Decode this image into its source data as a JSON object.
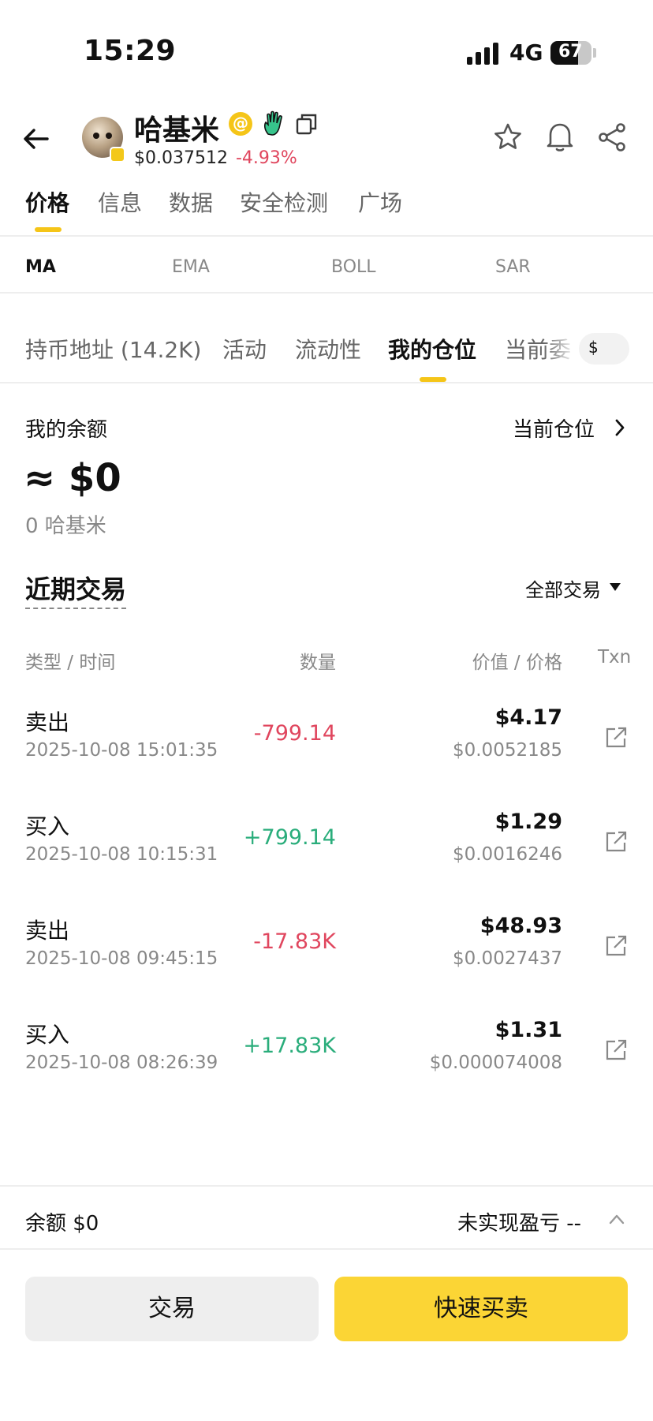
{
  "status_bar": {
    "time": "15:29",
    "network": "4G",
    "battery": "67"
  },
  "header": {
    "token_name": "哈基米",
    "price": "$0.037512",
    "change": "-4.93%",
    "change_color": "#e0465e"
  },
  "main_tabs": [
    "价格",
    "信息",
    "数据",
    "安全检测",
    "广场"
  ],
  "indicators": [
    "MA",
    "EMA",
    "BOLL",
    "SAR"
  ],
  "sub_tabs": [
    "持币地址 (14.2K)",
    "活动",
    "流动性",
    "我的仓位",
    "当前委"
  ],
  "currency_symbol": "$",
  "balance": {
    "label": "我的余额",
    "position_link": "当前仓位",
    "value": "≈ $0",
    "token_amount": "0 哈基米"
  },
  "recent": {
    "title": "近期交易",
    "filter": "全部交易",
    "columns": {
      "type_time": "类型 / 时间",
      "qty": "数量",
      "value_price": "价值 / 价格",
      "txn": "Txn"
    },
    "rows": [
      {
        "type": "卖出",
        "time": "2025-10-08 15:01:35",
        "qty": "-799.14",
        "value": "$4.17",
        "price": "$0.0052185"
      },
      {
        "type": "买入",
        "time": "2025-10-08 10:15:31",
        "qty": "+799.14",
        "value": "$1.29",
        "price": "$0.0016246"
      },
      {
        "type": "卖出",
        "time": "2025-10-08 09:45:15",
        "qty": "-17.83K",
        "value": "$48.93",
        "price": "$0.0027437"
      },
      {
        "type": "买入",
        "time": "2025-10-08 08:26:39",
        "qty": "+17.83K",
        "value": "$1.31",
        "price": "$0.000074008"
      }
    ]
  },
  "footer": {
    "balance": "余额 $0",
    "unrealized": "未实现盈亏 --",
    "trade_button": "交易",
    "quick_button": "快速买卖",
    "accent_color": "#fbd535"
  }
}
